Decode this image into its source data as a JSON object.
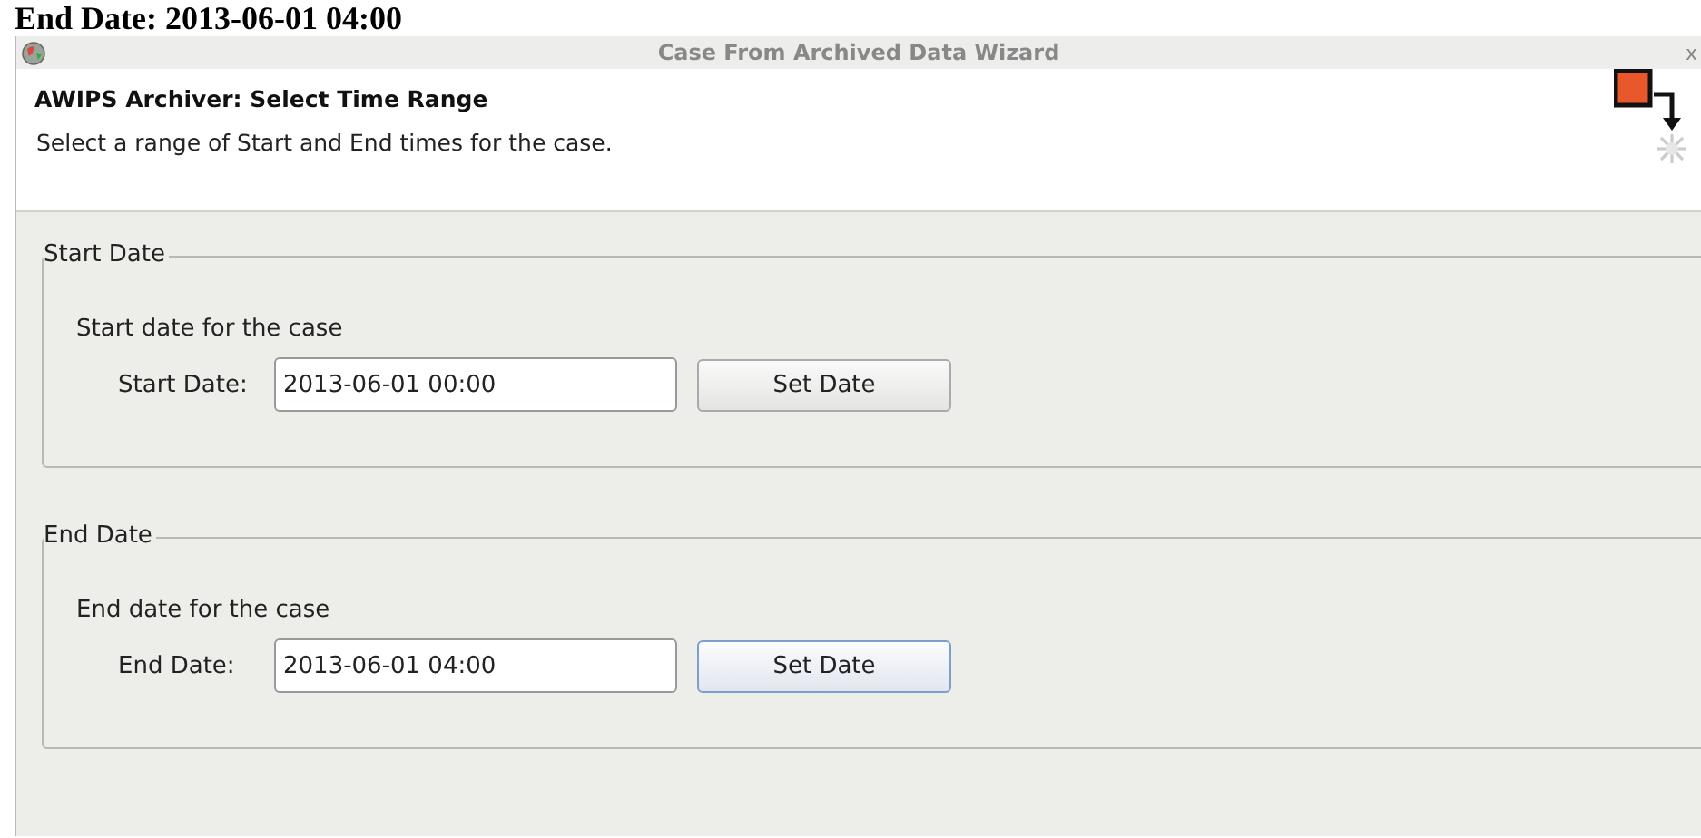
{
  "caption": "End Date: 2013-06-01 04:00",
  "window": {
    "title": "Case From Archived Data Wizard",
    "close": "x"
  },
  "header": {
    "title": "AWIPS Archiver: Select Time Range",
    "subtitle": "Select a range of Start and End times for the case."
  },
  "groups": [
    {
      "legend": "Start Date",
      "description": "Start date for the case",
      "label": "Start Date:",
      "value": "2013-06-01 00:00",
      "button": "Set Date",
      "focused": false
    },
    {
      "legend": "End Date",
      "description": "End date for the case",
      "label": "End Date:",
      "value": "2013-06-01 04:00",
      "button": "Set Date",
      "focused": true
    }
  ]
}
